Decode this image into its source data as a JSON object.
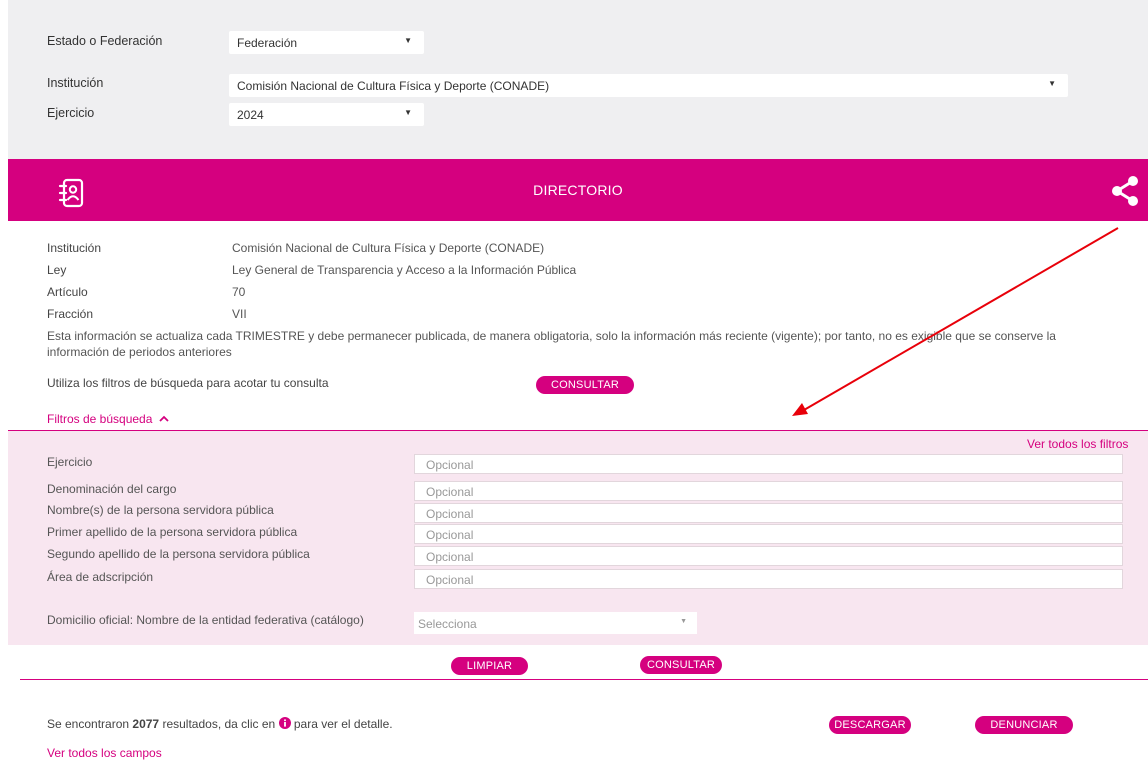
{
  "top": {
    "estado_label": "Estado o Federación",
    "estado_value": "Federación",
    "institucion_label": "Institución",
    "institucion_value": "Comisión Nacional de Cultura Física y Deporte (CONADE)",
    "ejercicio_label": "Ejercicio",
    "ejercicio_value": "2024"
  },
  "banner": {
    "title": "DIRECTORIO",
    "icon": "contact-book-icon",
    "share_icon": "share-icon",
    "color": "#d5007f"
  },
  "info": {
    "rows": [
      {
        "label": "Institución",
        "value": "Comisión Nacional de Cultura Física y Deporte (CONADE)"
      },
      {
        "label": "Ley",
        "value": "Ley General de Transparencia y Acceso a la Información Pública"
      },
      {
        "label": "Artículo",
        "value": "70"
      },
      {
        "label": "Fracción",
        "value": "VII"
      }
    ],
    "note": "Esta información se actualiza cada TRIMESTRE y debe permanecer publicada, de manera obligatoria, solo la información más reciente (vigente); por tanto, no es exigible que se conserve la información de periodos anteriores",
    "hint": "Utiliza los filtros de búsqueda para acotar tu consulta",
    "consultar": "CONSULTAR",
    "filtros_toggle": "Filtros de búsqueda",
    "filtros_toggle_icon": "chevron-up-icon"
  },
  "filters": {
    "ver_todos": "Ver todos los filtros",
    "fields": [
      {
        "label": "Ejercicio",
        "placeholder": "Opcional"
      },
      {
        "label": "Denominación del cargo",
        "placeholder": "Opcional"
      },
      {
        "label": "Nombre(s) de la persona servidora pública",
        "placeholder": "Opcional"
      },
      {
        "label": "Primer apellido de la persona servidora pública",
        "placeholder": "Opcional"
      },
      {
        "label": "Segundo apellido de la persona servidora pública",
        "placeholder": "Opcional"
      },
      {
        "label": "Área de adscripción",
        "placeholder": "Opcional"
      }
    ],
    "domicilio_label": "Domicilio oficial: Nombre de la entidad federativa (catálogo)",
    "domicilio_value": "Selecciona",
    "limpiar": "LIMPIAR",
    "consultar": "CONSULTAR"
  },
  "results": {
    "prefix": "Se encontraron",
    "count": "2077",
    "middle": "resultados, da clic en",
    "suffix": "para ver el detalle.",
    "info_icon": "info-icon",
    "descargar": "DESCARGAR",
    "denunciar": "DENUNCIAR",
    "ver_campos": "Ver todos los campos"
  },
  "annotation": {
    "arrow_color": "#e8000a"
  }
}
